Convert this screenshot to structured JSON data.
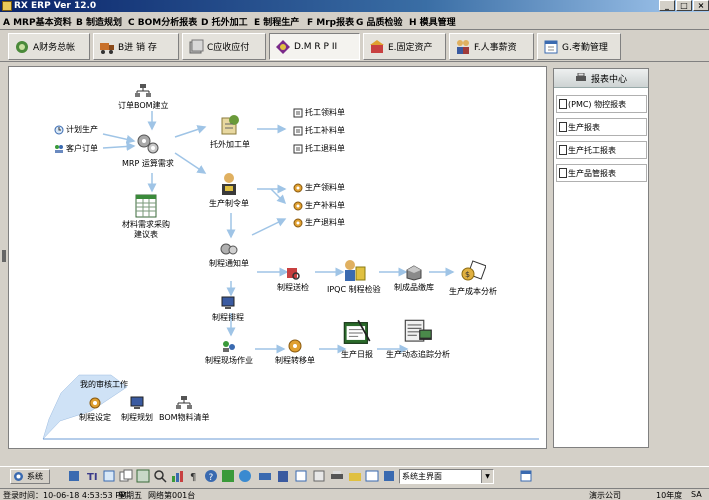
{
  "window": {
    "title": "RX ERP Ver 12.0",
    "min": "_",
    "max": "□",
    "close": "×"
  },
  "menu": [
    "A MRP基本资料",
    "B 制造规划",
    "C BOM分析报表",
    "D 托外加工",
    "E 制程生产",
    "F Mrp报表",
    "G 品质检验",
    "H 模具管理"
  ],
  "tabs": [
    {
      "label": "A财务总帐",
      "icon": "finance-icon"
    },
    {
      "label": "B进 销 存",
      "icon": "truck-icon"
    },
    {
      "label": "C应收应付",
      "icon": "receivable-icon"
    },
    {
      "label": "D.M R P II",
      "icon": "mrp-icon",
      "active": true
    },
    {
      "label": "E.固定资产",
      "icon": "asset-icon"
    },
    {
      "label": "F.人事薪资",
      "icon": "hr-icon"
    },
    {
      "label": "G.考勤管理",
      "icon": "attendance-icon"
    }
  ],
  "flow": {
    "order_bom": "订单BOM建立",
    "plan_production": "计划生产",
    "customer_order": "客户订单",
    "mrp_calc": "MRP 运算需求",
    "material_purchase": "材料需求采购\n建议表",
    "outsource_order": "托外加工单",
    "outsource_issue": "托工领料单",
    "outsource_supply": "托工补料单",
    "outsource_return": "托工退料单",
    "production_order": "生产制令单",
    "prod_issue": "生产领料单",
    "prod_supply": "生产补料单",
    "prod_return": "生产退料单",
    "process_notice": "制程通知单",
    "process_inspect": "制程送检",
    "ipqc": "IPQC 制程检验",
    "finished_storage": "制成品缴库",
    "cost_analysis": "生产成本分析",
    "process_schedule": "制程排程",
    "site_work": "制程现场作业",
    "process_transfer": "制程转移单",
    "daily_report": "生产日报",
    "dynamic_tracking": "生产动态追踪分析",
    "my_approval": "我的审核工作",
    "process_setting": "制程设定",
    "process_plan": "制程规划",
    "bom_list": "BOM物料清单"
  },
  "report_center": {
    "title": "报表中心",
    "items": [
      "(PMC) 物控报表",
      "生产报表",
      "生产托工报表",
      "生产品管报表"
    ]
  },
  "toolbar": {
    "system_label": "系统",
    "combo_value": "系统主界面"
  },
  "status": {
    "login_time": "登录时间：10-06-18 4:53:53 PM",
    "weekday": "星期五",
    "desk": "网络第001台",
    "company": "演示公司",
    "year": "10年度",
    "user": "SA"
  }
}
